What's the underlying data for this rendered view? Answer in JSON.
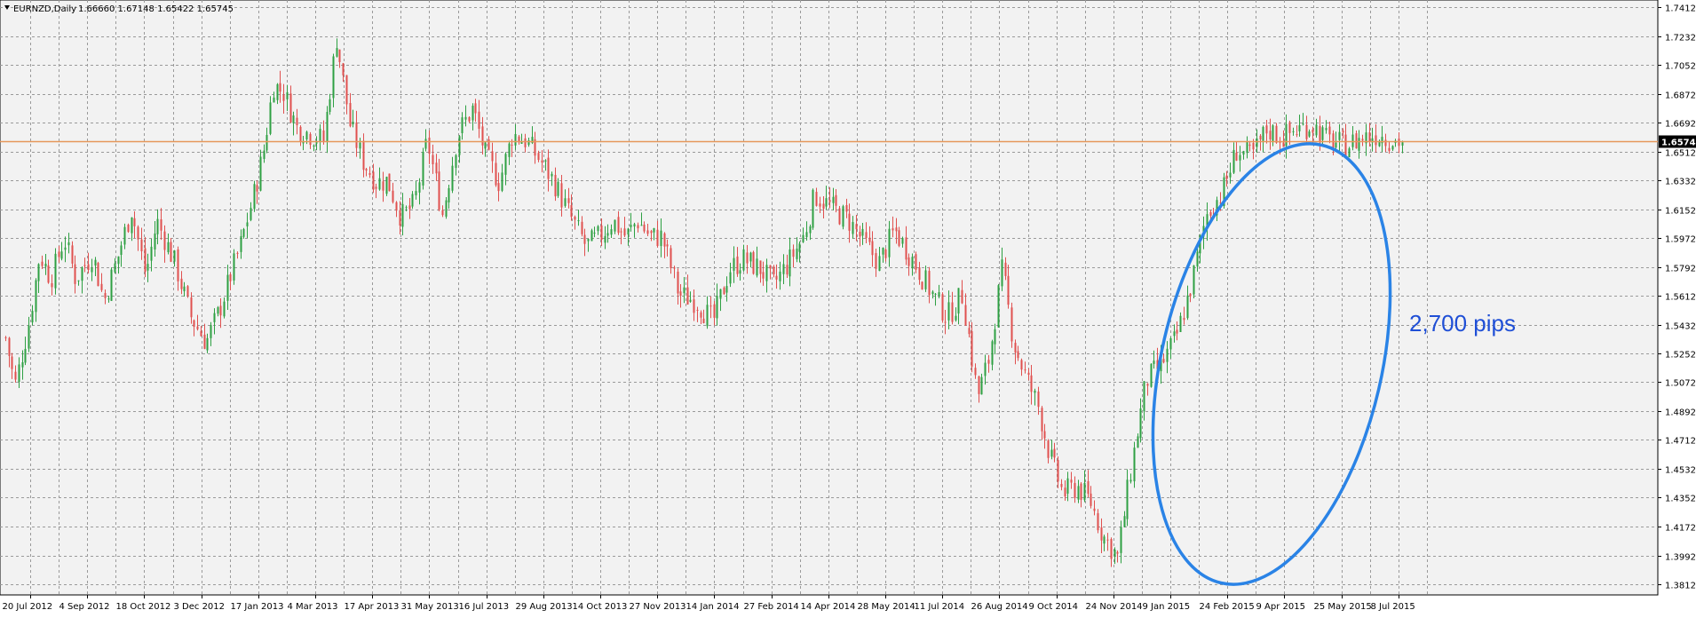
{
  "header": {
    "symbol_timeframe": "EURNZD,Daily",
    "ohlc": "1.66660 1.67148 1.65422 1.65745",
    "menu_icon": "triangle-down-icon"
  },
  "colors": {
    "background": "#f2f2f2",
    "grid": "#9a9a9a",
    "bull": "#2ea043",
    "bear": "#e0504f",
    "price_line": "#e6975a",
    "price_box": "#000000",
    "annotation": "#2a83e6",
    "annotation_text": "#1f4fd6"
  },
  "chart_data": {
    "type": "candlestick",
    "title": "",
    "xlabel": "",
    "ylabel": "",
    "ylim": [
      1.3812,
      1.7412
    ],
    "y_ticks": [
      "1.74120",
      "1.72320",
      "1.70520",
      "1.68720",
      "1.66920",
      "1.65120",
      "1.63320",
      "1.61520",
      "1.59720",
      "1.57920",
      "1.56120",
      "1.54320",
      "1.52520",
      "1.50720",
      "1.48920",
      "1.47120",
      "1.45320",
      "1.43520",
      "1.41720",
      "1.39920",
      "1.38120"
    ],
    "x_ticks": [
      "20 Jul 2012",
      "4 Sep 2012",
      "18 Oct 2012",
      "3 Dec 2012",
      "17 Jan 2013",
      "4 Mar 2013",
      "17 Apr 2013",
      "31 May 2013",
      "16 Jul 2013",
      "29 Aug 2013",
      "14 Oct 2013",
      "27 Nov 2013",
      "14 Jan 2014",
      "27 Feb 2014",
      "14 Apr 2014",
      "28 May 2014",
      "11 Jul 2014",
      "26 Aug 2014",
      "9 Oct 2014",
      "24 Nov 2014",
      "9 Jan 2015",
      "24 Feb 2015",
      "9 Apr 2015",
      "25 May 2015",
      "8 Jul 2015"
    ],
    "current_price": "1.65745",
    "anchors": [
      [
        0,
        1.535
      ],
      [
        10,
        1.505
      ],
      [
        24,
        1.542
      ],
      [
        36,
        1.587
      ],
      [
        48,
        1.572
      ],
      [
        62,
        1.597
      ],
      [
        74,
        1.572
      ],
      [
        92,
        1.587
      ],
      [
        104,
        1.558
      ],
      [
        118,
        1.584
      ],
      [
        133,
        1.615
      ],
      [
        148,
        1.574
      ],
      [
        160,
        1.608
      ],
      [
        178,
        1.583
      ],
      [
        196,
        1.548
      ],
      [
        212,
        1.532
      ],
      [
        226,
        1.552
      ],
      [
        248,
        1.592
      ],
      [
        264,
        1.628
      ],
      [
        274,
        1.655
      ],
      [
        283,
        1.693
      ],
      [
        294,
        1.688
      ],
      [
        308,
        1.666
      ],
      [
        322,
        1.662
      ],
      [
        336,
        1.658
      ],
      [
        350,
        1.722
      ],
      [
        364,
        1.668
      ],
      [
        378,
        1.645
      ],
      [
        392,
        1.632
      ],
      [
        404,
        1.633
      ],
      [
        418,
        1.61
      ],
      [
        432,
        1.618
      ],
      [
        446,
        1.658
      ],
      [
        462,
        1.612
      ],
      [
        478,
        1.662
      ],
      [
        494,
        1.678
      ],
      [
        508,
        1.648
      ],
      [
        522,
        1.632
      ],
      [
        536,
        1.662
      ],
      [
        550,
        1.658
      ],
      [
        566,
        1.645
      ],
      [
        580,
        1.632
      ],
      [
        596,
        1.612
      ],
      [
        614,
        1.592
      ],
      [
        628,
        1.598
      ],
      [
        642,
        1.608
      ],
      [
        656,
        1.598
      ],
      [
        668,
        1.608
      ],
      [
        682,
        1.598
      ],
      [
        694,
        1.598
      ],
      [
        712,
        1.562
      ],
      [
        730,
        1.558
      ],
      [
        748,
        1.545
      ],
      [
        766,
        1.578
      ],
      [
        780,
        1.584
      ],
      [
        798,
        1.578
      ],
      [
        812,
        1.568
      ],
      [
        828,
        1.582
      ],
      [
        844,
        1.598
      ],
      [
        856,
        1.624
      ],
      [
        872,
        1.617
      ],
      [
        892,
        1.608
      ],
      [
        908,
        1.594
      ],
      [
        924,
        1.582
      ],
      [
        940,
        1.602
      ],
      [
        958,
        1.585
      ],
      [
        980,
        1.562
      ],
      [
        996,
        1.548
      ],
      [
        1012,
        1.562
      ],
      [
        1028,
        1.498
      ],
      [
        1040,
        1.522
      ],
      [
        1054,
        1.578
      ],
      [
        1066,
        1.532
      ],
      [
        1078,
        1.512
      ],
      [
        1092,
        1.492
      ],
      [
        1104,
        1.462
      ],
      [
        1118,
        1.438
      ],
      [
        1134,
        1.442
      ],
      [
        1148,
        1.432
      ],
      [
        1160,
        1.412
      ],
      [
        1176,
        1.398
      ],
      [
        1190,
        1.452
      ],
      [
        1206,
        1.508
      ],
      [
        1222,
        1.518
      ],
      [
        1238,
        1.535
      ],
      [
        1254,
        1.568
      ],
      [
        1270,
        1.612
      ],
      [
        1286,
        1.625
      ],
      [
        1302,
        1.652
      ],
      [
        1318,
        1.648
      ],
      [
        1334,
        1.665
      ],
      [
        1350,
        1.66
      ],
      [
        1366,
        1.665
      ],
      [
        1382,
        1.668
      ],
      [
        1398,
        1.658
      ],
      [
        1418,
        1.655
      ],
      [
        1436,
        1.66
      ],
      [
        1452,
        1.662
      ],
      [
        1468,
        1.658
      ],
      [
        1480,
        1.657
      ]
    ]
  },
  "annotation": {
    "label": "2,700 pips",
    "shape": "ellipse"
  }
}
